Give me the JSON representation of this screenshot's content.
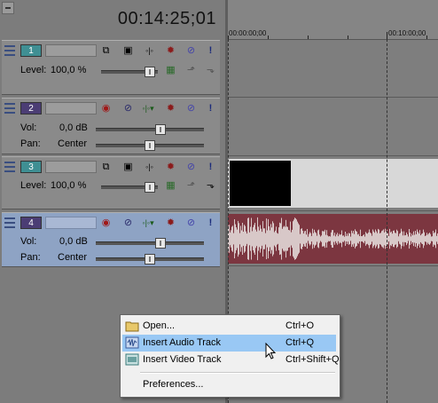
{
  "header": {
    "timecode": "00:14:25;01"
  },
  "tracks": [
    {
      "number": "1",
      "kind": "video",
      "level_label": "Level:",
      "level_value": "100,0 %",
      "level": 0.95
    },
    {
      "number": "2",
      "kind": "audio",
      "vol_label": "Vol:",
      "vol_value": "0,0 dB",
      "vol": 0.6,
      "pan_label": "Pan:",
      "pan_value": "Center",
      "pan": 0.5
    },
    {
      "number": "3",
      "kind": "video",
      "level_label": "Level:",
      "level_value": "100,0 %",
      "level": 0.95
    },
    {
      "number": "4",
      "kind": "audio",
      "selected": true,
      "vol_label": "Vol:",
      "vol_value": "0,0 dB",
      "vol": 0.6,
      "pan_label": "Pan:",
      "pan_value": "Center",
      "pan": 0.5
    }
  ],
  "ruler": {
    "start": "00:00:00;00",
    "mark": "00:10:00;00"
  },
  "context_menu": {
    "items": [
      {
        "label": "Open...",
        "shortcut": "Ctrl+O",
        "icon": "folder-icon"
      },
      {
        "label": "Insert Audio Track",
        "shortcut": "Ctrl+Q",
        "icon": "audio-track-icon",
        "highlighted": true
      },
      {
        "label": "Insert Video Track",
        "shortcut": "Ctrl+Shift+Q",
        "icon": "video-track-icon"
      },
      {
        "label": "Preferences...",
        "shortcut": ""
      }
    ]
  },
  "colors": {
    "audio_waveform_bg": "#7c3640",
    "audio_waveform": "#d8c8c8",
    "menu_highlight": "#99c8f4",
    "video_track_num": "#3f8f93",
    "audio_track_num": "#4b3d74"
  }
}
